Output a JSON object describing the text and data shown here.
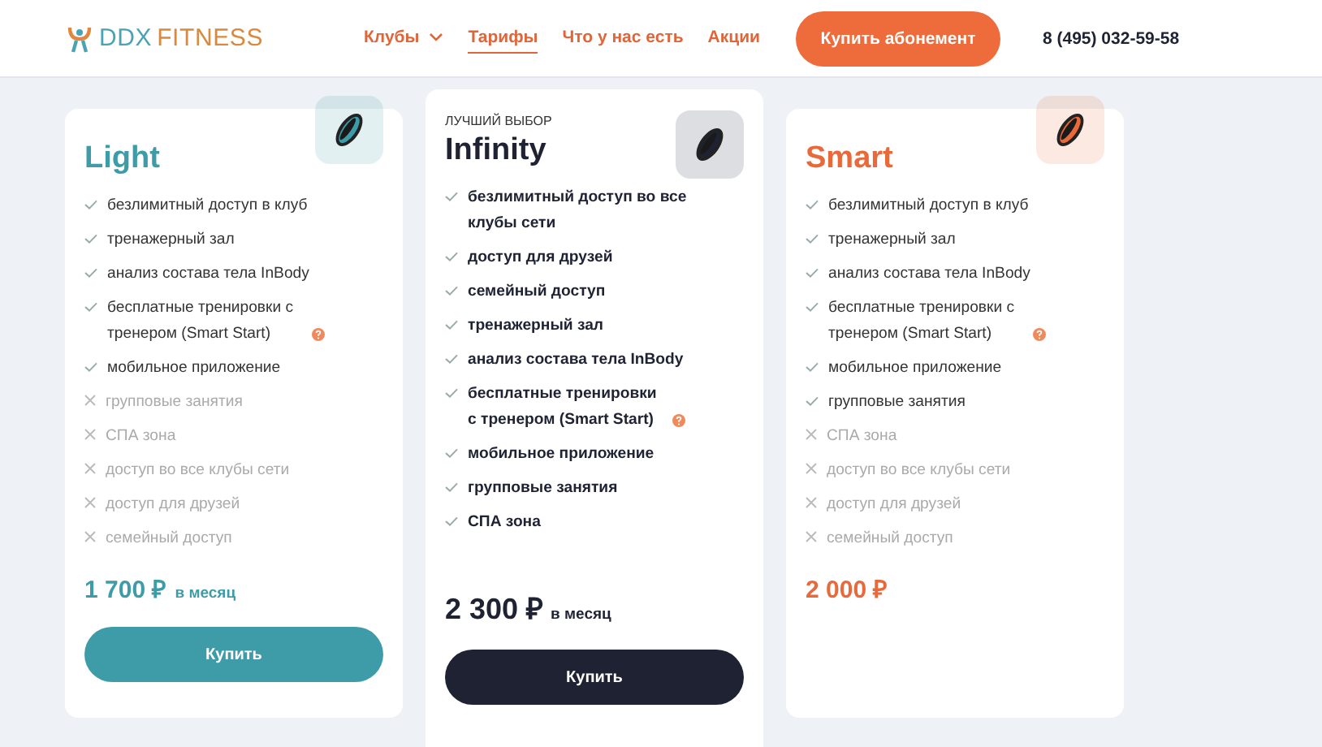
{
  "header": {
    "logo": {
      "part_1": "DDX",
      "part_2": "FITNESS"
    },
    "nav": [
      {
        "label": "Клубы",
        "dropdown": true,
        "selected": false
      },
      {
        "label": "Тарифы",
        "dropdown": false,
        "selected": true
      },
      {
        "label": "Что у нас есть",
        "dropdown": false,
        "selected": false
      },
      {
        "label": "Акции",
        "dropdown": false,
        "selected": false
      }
    ],
    "cta": "Купить абонемент",
    "phone": "8 (495) 032-59-58"
  },
  "plans": [
    {
      "color": "#3d9ca7",
      "name": "Light",
      "features": [
        {
          "text": "безлимитный доступ в клуб",
          "included": true,
          "help": false
        },
        {
          "text": "тренажерный зал",
          "included": true,
          "help": false
        },
        {
          "text": "анализ состава тела InBody",
          "included": true,
          "help": false
        },
        {
          "text": "бесплатные тренировки с тренером (Smart Start)",
          "included": true,
          "help": true
        },
        {
          "text": "мобильное приложение",
          "included": true,
          "help": false
        },
        {
          "text": "групповые занятия",
          "included": false,
          "help": false
        },
        {
          "text": "СПА зона",
          "included": false,
          "help": false
        },
        {
          "text": "доступ во все клубы сети",
          "included": false,
          "help": false
        },
        {
          "text": "доступ для друзей",
          "included": false,
          "help": false
        },
        {
          "text": "семейный доступ",
          "included": false,
          "help": false
        }
      ],
      "price": "1 700 ₽",
      "per": "в месяц",
      "button": "Купить"
    },
    {
      "color": "#1e2233",
      "badge": "ЛУЧШИЙ ВЫБОР",
      "name": "Infinity",
      "features": [
        {
          "text": "безлимитный доступ во все клубы сети",
          "included": true,
          "help": false
        },
        {
          "text": "доступ для друзей",
          "included": true,
          "help": false
        },
        {
          "text": "семейный доступ",
          "included": true,
          "help": false
        },
        {
          "text": "тренажерный зал",
          "included": true,
          "help": false
        },
        {
          "text": "анализ состава тела InBody",
          "included": true,
          "help": false
        },
        {
          "text": "бесплатные тренировки с тренером (Smart Start)",
          "included": true,
          "help": true
        },
        {
          "text": "мобильное приложение",
          "included": true,
          "help": false
        },
        {
          "text": "групповые занятия",
          "included": true,
          "help": false
        },
        {
          "text": "СПА зона",
          "included": true,
          "help": false
        }
      ],
      "price": "2 300 ₽",
      "per": "в месяц",
      "button": "Купить"
    },
    {
      "color": "#e8693a",
      "name": "Smart",
      "features": [
        {
          "text": "безлимитный доступ в клуб",
          "included": true,
          "help": false
        },
        {
          "text": "тренажерный зал",
          "included": true,
          "help": false
        },
        {
          "text": "анализ состава тела InBody",
          "included": true,
          "help": false
        },
        {
          "text": "бесплатные тренировки с тренером (Smart Start)",
          "included": true,
          "help": true
        },
        {
          "text": "мобильное приложение",
          "included": true,
          "help": false
        },
        {
          "text": "групповые занятия",
          "included": true,
          "help": false
        },
        {
          "text": "СПА зона",
          "included": false,
          "help": false
        },
        {
          "text": "доступ во все клубы сети",
          "included": false,
          "help": false
        },
        {
          "text": "доступ для друзей",
          "included": false,
          "help": false
        },
        {
          "text": "семейный доступ",
          "included": false,
          "help": false
        }
      ],
      "price": "2 000 ₽"
    }
  ]
}
